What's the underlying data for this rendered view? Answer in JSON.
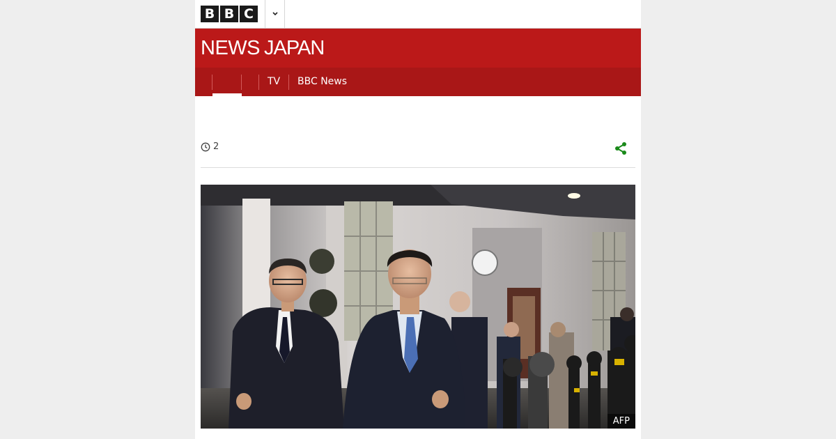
{
  "masthead": {
    "logo_letters": [
      "B",
      "B",
      "C"
    ],
    "menu_icon": "chevron-down-icon"
  },
  "banner": {
    "brand_news": "NEWS",
    "brand_region": "JAPAN",
    "background_color": "#bb1919"
  },
  "nav": {
    "items": [
      {
        "label": ""
      },
      {
        "label": "TV"
      },
      {
        "label": "BBC News"
      }
    ],
    "background_color": "#a91717"
  },
  "article": {
    "reading_time": "2",
    "share_icon": "share-icon",
    "share_color": "#1a8a1a"
  },
  "hero": {
    "credit": "AFP"
  }
}
